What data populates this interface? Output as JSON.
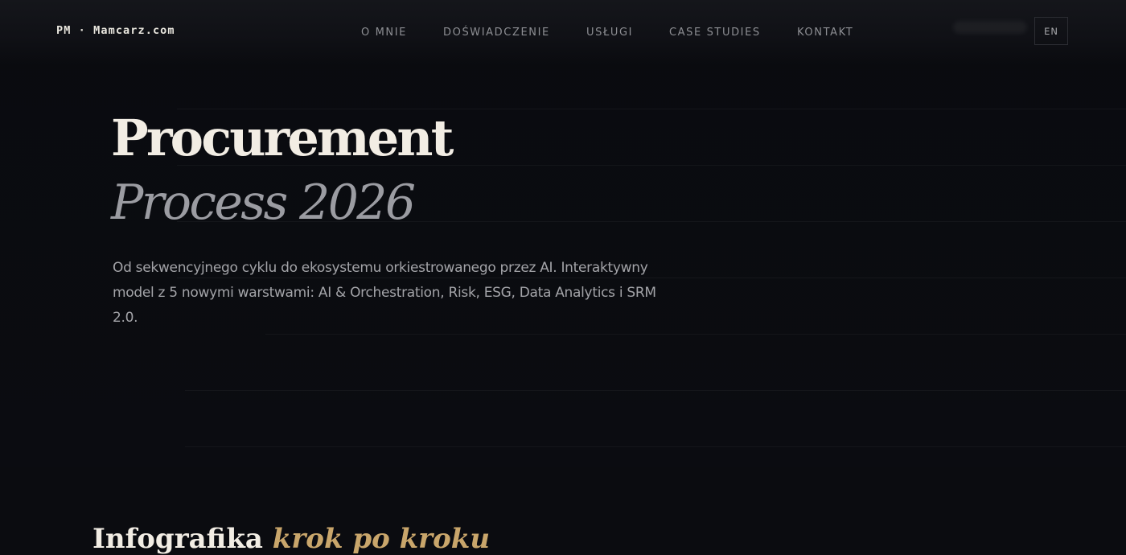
{
  "header": {
    "logo": "PM · Mamcarz.com",
    "nav": [
      {
        "label": "O MNIE"
      },
      {
        "label": "DOŚWIADCZENIE"
      },
      {
        "label": "USŁUGI"
      },
      {
        "label": "CASE STUDIES"
      },
      {
        "label": "KONTAKT"
      }
    ],
    "lang": "EN"
  },
  "hero": {
    "title_line1": "Procurement",
    "title_line2": "Process 2026",
    "lede": "Od sekwencyjnego cyklu do ekosystemu orkiestrowanego przez AI. Interaktywny model z 5 nowymi warstwami: AI & Orchestration, Risk, ESG, Data Analytics i SRM 2.0."
  },
  "next_section": {
    "title_start": "Infografika",
    "title_accent": "krok po kroku"
  },
  "colors": {
    "background": "#0b0c10",
    "title": "#f2ede4",
    "title_italic": "#9b9ca2",
    "body_text": "#a3a4a8",
    "nav_text": "#8d8e93",
    "accent_gold": "#c9a66b"
  }
}
